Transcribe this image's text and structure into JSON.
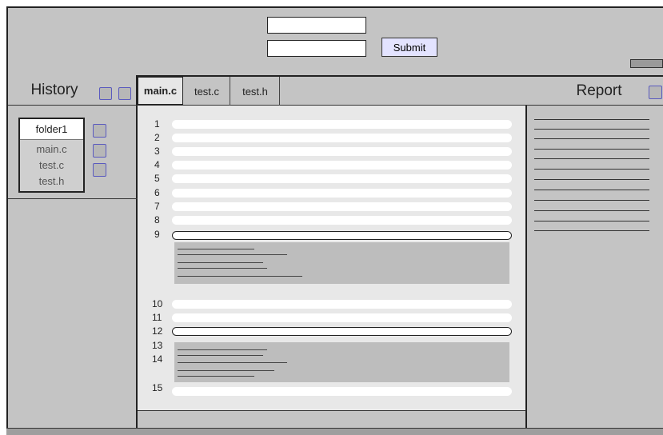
{
  "header": {
    "input1_value": "",
    "input2_value": "",
    "submit_label": "Submit"
  },
  "history": {
    "title": "History",
    "folder": "folder1",
    "files": [
      "main.c",
      "test.c",
      "test.h"
    ]
  },
  "tabs": [
    {
      "label": "main.c",
      "active": true
    },
    {
      "label": "test.c",
      "active": false
    },
    {
      "label": "test.h",
      "active": false
    }
  ],
  "editor": {
    "line_numbers": [
      "1",
      "2",
      "3",
      "4",
      "5",
      "6",
      "7",
      "8",
      "9",
      "10",
      "11",
      "12",
      "13",
      "14",
      "15"
    ],
    "selected_lines": [
      "9",
      "12"
    ]
  },
  "report": {
    "title": "Report"
  },
  "colors": {
    "panel_bg": "#c4c4c4",
    "editor_bg": "#e8e8e8",
    "button_accent": "#e3e3ff",
    "icon_border": "#5a5abf"
  }
}
